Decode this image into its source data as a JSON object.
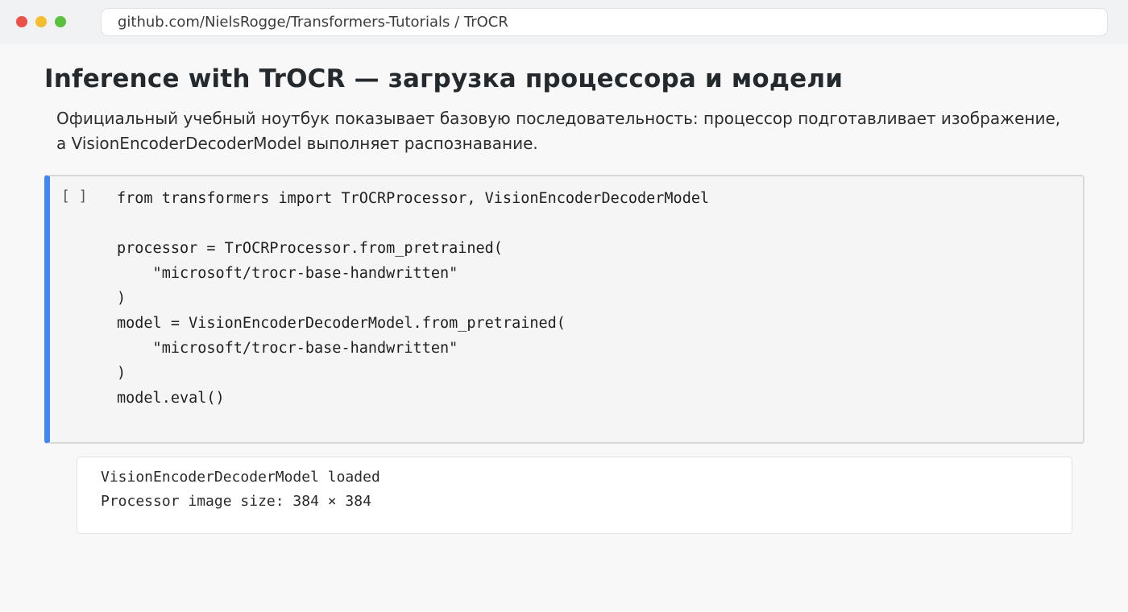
{
  "browser": {
    "url": "github.com/NielsRogge/Transformers-Tutorials / TrOCR"
  },
  "notebook": {
    "heading": "Inference with TrOCR — загрузка процессора и модели",
    "description": [
      "Официальный учебный ноутбук показывает базовую последовательность: процессор подготавливает изображение,",
      "а VisionEncoderDecoderModel выполняет распознавание."
    ],
    "cell": {
      "run_indicator": "[ ]",
      "code": "from transformers import TrOCRProcessor, VisionEncoderDecoderModel\n\nprocessor = TrOCRProcessor.from_pretrained(\n    \"microsoft/trocr-base-handwritten\"\n)\nmodel = VisionEncoderDecoderModel.from_pretrained(\n    \"microsoft/trocr-base-handwritten\"\n)\nmodel.eval()",
      "output": "VisionEncoderDecoderModel loaded\nProcessor image size: 384 × 384"
    }
  },
  "colors": {
    "cell_accent": "#4285f4",
    "close": "#ec5149",
    "minimize": "#f4bd30",
    "maximize": "#5cc03f"
  }
}
